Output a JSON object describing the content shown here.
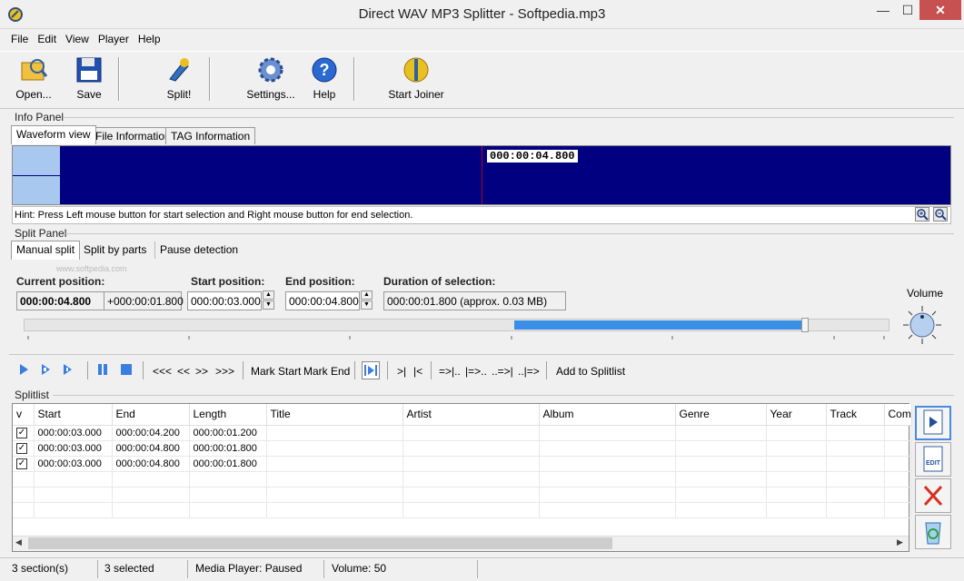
{
  "window": {
    "title": "Direct WAV MP3 Splitter - Softpedia.mp3",
    "min": "—",
    "max": "☐",
    "close": "✕"
  },
  "menu": [
    "File",
    "Edit",
    "View",
    "Player",
    "Help"
  ],
  "toolbar": {
    "open": "Open...",
    "save": "Save",
    "split": "Split!",
    "settings": "Settings...",
    "help": "Help",
    "start_joiner": "Start Joiner"
  },
  "info_panel": {
    "label": "Info Panel",
    "tabs": [
      "Waveform view",
      "File Information",
      "TAG Information"
    ],
    "cursor_time": "000:00:04.800",
    "hint": "Hint: Press Left mouse button for start selection and Right mouse button for end selection."
  },
  "split_panel": {
    "label": "Split Panel",
    "tabs": [
      "Manual split",
      "Split by parts",
      "Pause detection"
    ],
    "current_position_label": "Current position:",
    "current_position": "000:00:04.800",
    "current_offset": "+000:00:01.800",
    "start_position_label": "Start position:",
    "start_position": "000:00:03.000",
    "end_position_label": "End position:",
    "end_position": "000:00:04.800",
    "duration_label": "Duration of selection:",
    "duration": "000:00:01.800  (approx. 0.03 MB)",
    "volume_label": "Volume",
    "watermark": "www.softpedia.com"
  },
  "controls": {
    "rewind": "<<<",
    "back": "<<",
    "fwd": ">>",
    "ffwd": ">>>",
    "mark_start": "Mark Start",
    "mark_end": "Mark End",
    "goto_start": ">|",
    "goto_end": "|<",
    "c1": "=>|..",
    "c2": "|=>..",
    "c3": "..=>|",
    "c4": "..|=>",
    "add": "Add to Splitlist"
  },
  "splitlist": {
    "label": "Splitlist",
    "columns": [
      "v",
      "Start",
      "End",
      "Length",
      "Title",
      "Artist",
      "Album",
      "Genre",
      "Year",
      "Track",
      "Com"
    ],
    "rows": [
      {
        "checked": "✓",
        "start": "000:00:03.000",
        "end": "000:00:04.200",
        "length": "000:00:01.200"
      },
      {
        "checked": "✓",
        "start": "000:00:03.000",
        "end": "000:00:04.800",
        "length": "000:00:01.800"
      },
      {
        "checked": "✓",
        "start": "000:00:03.000",
        "end": "000:00:04.800",
        "length": "000:00:01.800"
      }
    ]
  },
  "status": {
    "sections": "3 section(s)",
    "selected": "3 selected",
    "player": "Media Player: Paused",
    "volume": "Volume: 50"
  },
  "colors": {
    "waveform_bg": "#000080",
    "selection": "#a8c8f0",
    "slider_sel": "#3a8ee6",
    "cursor": "#b00020"
  }
}
